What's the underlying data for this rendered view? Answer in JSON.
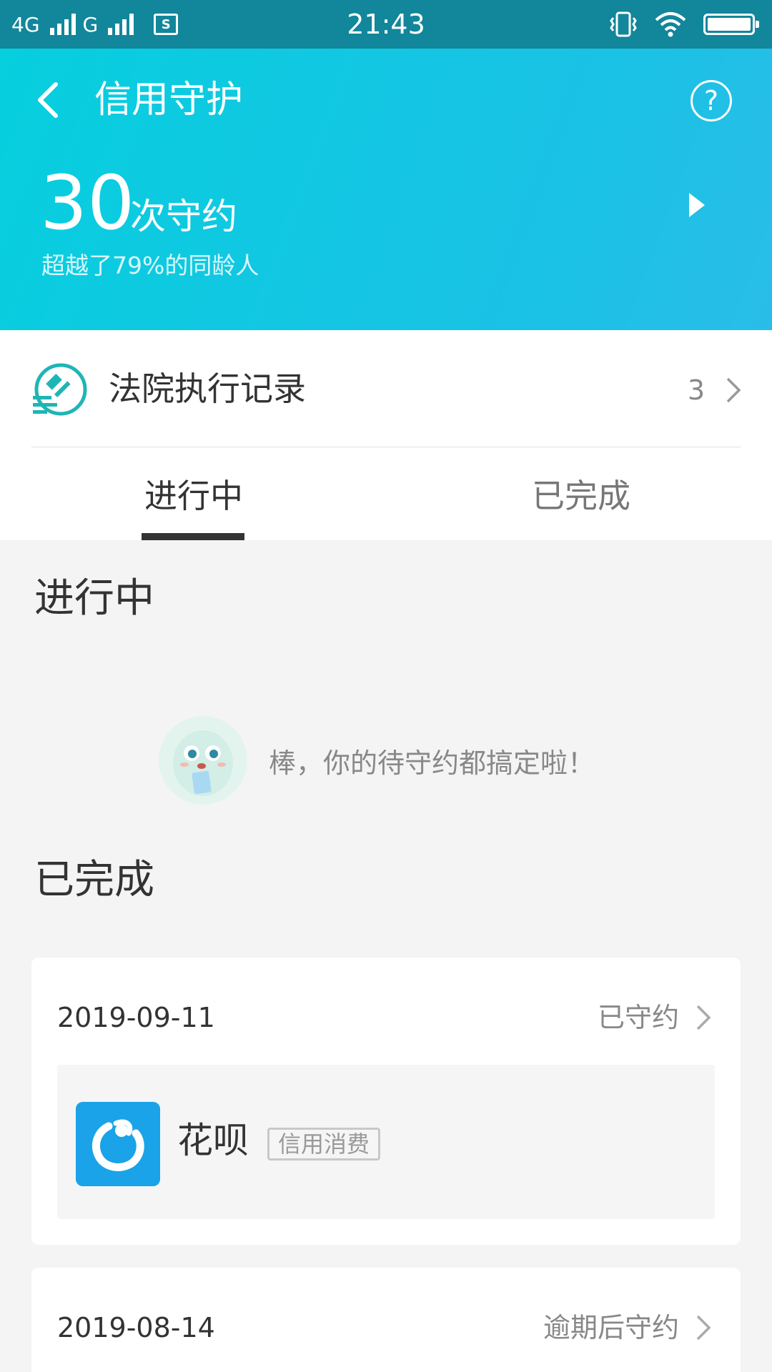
{
  "status_bar": {
    "network_1": "4G",
    "network_2": "G",
    "sim_label": "S",
    "time": "21:43"
  },
  "header": {
    "title": "信用守护",
    "score": "30",
    "score_unit": "次守约",
    "score_subtitle": "超越了79%的同龄人",
    "help_glyph": "?"
  },
  "court_record": {
    "label": "法院执行记录",
    "count": "3"
  },
  "tabs": [
    {
      "label": "进行中",
      "active": true
    },
    {
      "label": "已完成",
      "active": false
    }
  ],
  "sections": {
    "ongoing_title": "进行中",
    "empty_text": "棒，你的待守约都搞定啦！",
    "done_title": "已完成"
  },
  "records": [
    {
      "date": "2019-09-11",
      "status": "已守约",
      "app_name": "花呗",
      "tag": "信用消费"
    },
    {
      "date": "2019-08-14",
      "status": "逾期后守约"
    }
  ],
  "icons": {
    "back": "back-arrow-icon",
    "help": "help-circle-icon",
    "play": "play-triangle-icon",
    "court": "gavel-icon",
    "chevron": "chevron-right-icon",
    "mascot": "mascot-icon",
    "app_logo": "huabei-logo-icon"
  },
  "colors": {
    "header_start": "#06cfde",
    "header_end": "#29bde8",
    "status_bar": "#12869a",
    "accent": "#1fb5b5",
    "app_logo": "#1aa3e8",
    "page_bg": "#f4f4f4"
  }
}
